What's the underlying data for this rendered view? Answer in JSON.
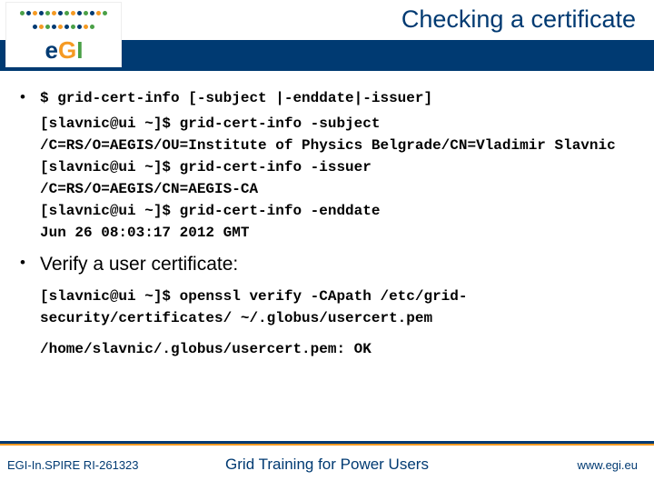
{
  "header": {
    "title": "Checking a certificate",
    "logo_text": "eGI"
  },
  "bullets": {
    "cmd_syntax": "$ grid-cert-info [-subject |-enddate|-issuer]",
    "lines": [
      "[slavnic@ui ~]$ grid-cert-info -subject",
      "/C=RS/O=AEGIS/OU=Institute of Physics Belgrade/CN=Vladimir Slavnic",
      "[slavnic@ui ~]$ grid-cert-info -issuer",
      "/C=RS/O=AEGIS/CN=AEGIS-CA",
      "[slavnic@ui ~]$ grid-cert-info -enddate",
      "Jun 26 08:03:17 2012 GMT"
    ],
    "verify_intro": "Verify a user certificate:",
    "verify_lines": [
      "[slavnic@ui ~]$ openssl verify -CApath /etc/grid-security/certificates/ ~/.globus/usercert.pem",
      "/home/slavnic/.globus/usercert.pem: OK"
    ]
  },
  "footer": {
    "left": "EGI-In.SPIRE RI-261323",
    "center": "Grid Training for Power Users",
    "right": "www.egi.eu"
  },
  "logo_dot_colors": [
    "#4aa047",
    "#003a72",
    "#f59a23",
    "#003a72",
    "#4aa047",
    "#f59a23",
    "#003a72",
    "#4aa047",
    "#f59a23",
    "#003a72",
    "#4aa047",
    "#003a72",
    "#f59a23",
    "#4aa047",
    "#003a72",
    "#f59a23",
    "#4aa047",
    "#003a72",
    "#f59a23",
    "#003a72",
    "#4aa047",
    "#003a72",
    "#f59a23",
    "#4aa047"
  ]
}
